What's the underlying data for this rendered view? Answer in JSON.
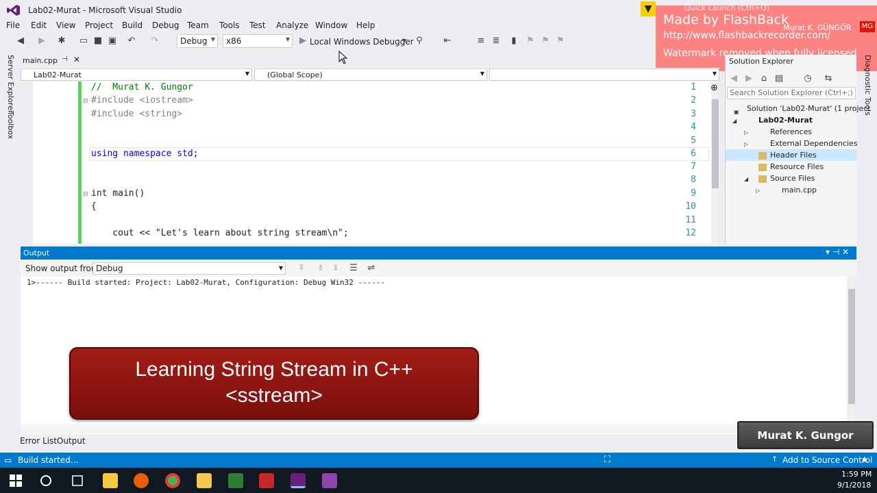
{
  "window": {
    "title": "Lab02-Murat - Microsoft Visual Studio",
    "quick_launch_placeholder": "Quick Launch (Ctrl+Q)",
    "user": "Murat K. GÜNGÖR",
    "user_initials": "MG"
  },
  "menu": [
    "File",
    "Edit",
    "View",
    "Project",
    "Build",
    "Debug",
    "Team",
    "Tools",
    "Test",
    "Analyze",
    "Window",
    "Help"
  ],
  "toolbar": {
    "config": "Debug",
    "platform": "x86",
    "run_target": "Local Windows Debugger"
  },
  "watermark": {
    "line1": "Made by FlashBack",
    "line2": "http://www.flashbackrecorder.com/",
    "line3": "Watermark removed when fully licensed"
  },
  "side_tabs": [
    "Server Explorer",
    "Toolbox"
  ],
  "right_tab": "Diagnostic Tools",
  "document_tab": "main.cpp",
  "navbar": {
    "project": "Lab02-Murat",
    "scope": "(Global Scope)"
  },
  "code_lines": [
    {
      "n": "1",
      "text": "//  Murat K. Gungor"
    },
    {
      "n": "2",
      "text": "#include <iostream>"
    },
    {
      "n": "3",
      "text": "#include <string>"
    },
    {
      "n": "4",
      "text": ""
    },
    {
      "n": "5",
      "text": ""
    },
    {
      "n": "6",
      "text": "using namespace std;"
    },
    {
      "n": "7",
      "text": ""
    },
    {
      "n": "8",
      "text": ""
    },
    {
      "n": "9",
      "text": "int main()"
    },
    {
      "n": "10",
      "text": "{"
    },
    {
      "n": "11",
      "text": ""
    },
    {
      "n": "12",
      "text": "    cout << \"Let's learn about string stream\\n\";"
    }
  ],
  "solution_explorer": {
    "title": "Solution Explorer",
    "search_placeholder": "Search Solution Explorer (Ctrl+;)",
    "solution": "Solution 'Lab02-Murat' (1 project",
    "project": "Lab02-Murat",
    "nodes": [
      "References",
      "External Dependencies",
      "Header Files",
      "Resource Files",
      "Source Files",
      "main.cpp"
    ]
  },
  "output": {
    "title": "Output",
    "show_from_label": "Show output from:",
    "source": "Debug",
    "line": "1>------ Build started: Project: Lab02-Murat, Configuration: Debug Win32 ------"
  },
  "banner": {
    "line1": "Learning String Stream in C++",
    "line2": "<sstream>"
  },
  "bottom_tabs": [
    "Error List",
    "Output"
  ],
  "author_badge": "Murat K. Gungor",
  "status": {
    "text": "Build started...",
    "right": "Add to Source Control"
  },
  "clock": {
    "time": "1:59 PM",
    "date": "9/1/2018"
  },
  "colors": {
    "accent": "#007acc",
    "banner": "#a31c16",
    "watermark": "#ff6e6e"
  }
}
